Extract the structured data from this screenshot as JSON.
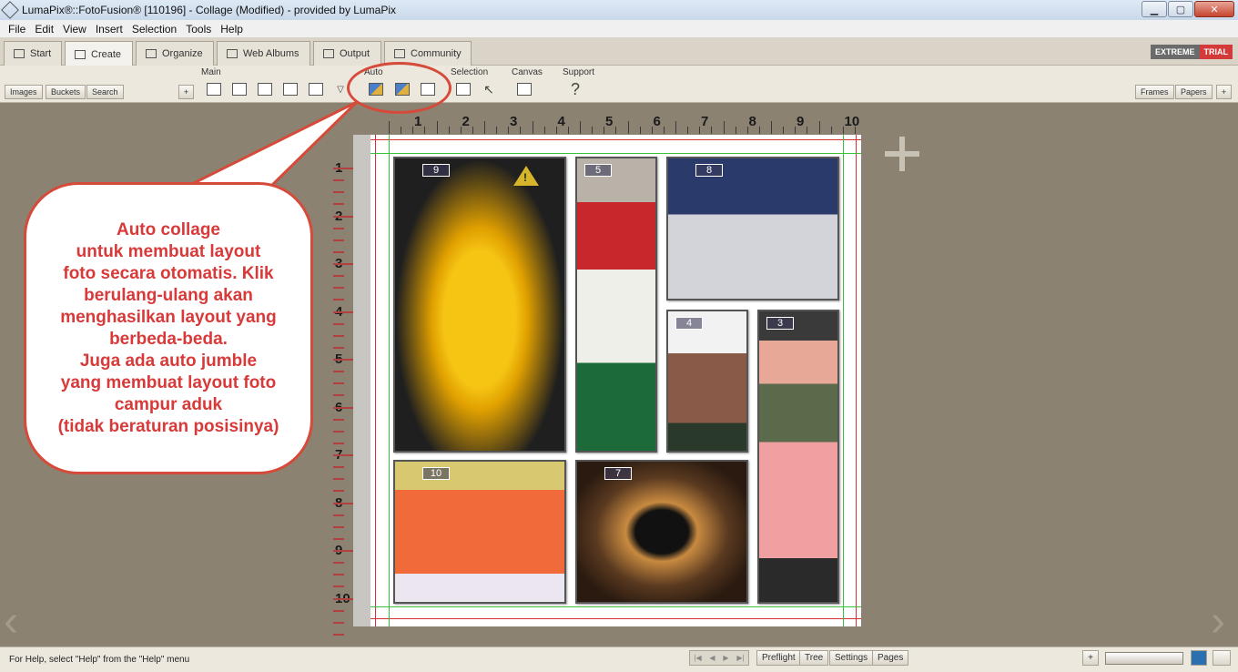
{
  "window": {
    "title": "LumaPix®::FotoFusion® [110196] - Collage (Modified) - provided by LumaPix",
    "minimize": "▁",
    "maximize": "▢",
    "close": "✕"
  },
  "menu": [
    "File",
    "Edit",
    "View",
    "Insert",
    "Selection",
    "Tools",
    "Help"
  ],
  "tabs": [
    {
      "label": "Start",
      "icon": "grid-icon"
    },
    {
      "label": "Create",
      "icon": "create-icon",
      "active": true
    },
    {
      "label": "Organize",
      "icon": "list-icon"
    },
    {
      "label": "Web Albums",
      "icon": "album-icon"
    },
    {
      "label": "Output",
      "icon": "arrow-icon"
    },
    {
      "label": "Community",
      "icon": "people-icon"
    }
  ],
  "edition": {
    "left": "EXTREME",
    "right": "TRIAL"
  },
  "toolbar": {
    "groups": [
      "Main",
      "Auto",
      "Selection",
      "Canvas",
      "Support"
    ],
    "left_buttons": [
      "Images",
      "Buckets",
      "Search"
    ],
    "right_buttons": [
      "Frames",
      "Papers"
    ],
    "plus": "+",
    "help_glyph": "?"
  },
  "ruler": {
    "h": [
      "1",
      "2",
      "3",
      "4",
      "5",
      "6",
      "7",
      "8",
      "9",
      "10"
    ],
    "v": [
      "1",
      "2",
      "3",
      "4",
      "5",
      "6",
      "7",
      "8",
      "9",
      "10"
    ]
  },
  "photos": [
    {
      "id": "9",
      "name": "juice-photo"
    },
    {
      "id": "5",
      "name": "snowman-photo"
    },
    {
      "id": "8",
      "name": "motorbike-photo"
    },
    {
      "id": "4",
      "name": "castle-photo"
    },
    {
      "id": "3",
      "name": "carnation-photo"
    },
    {
      "id": "10",
      "name": "papaya-photo"
    },
    {
      "id": "7",
      "name": "fountain-photo"
    }
  ],
  "callout": {
    "text": "Auto collage\nuntuk membuat layout\nfoto secara otomatis. Klik\nberulang-ulang akan\nmenghasilkan layout yang\nberbeda-beda.\nJuga ada auto jumble\nyang membuat layout foto\ncampur aduk\n(tidak beraturan posisinya)"
  },
  "status": {
    "help": "For Help, select \"Help\" from the \"Help\" menu",
    "buttons": [
      "Preflight",
      "Tree",
      "Settings",
      "Pages"
    ],
    "plus": "+"
  },
  "colors": {
    "accent": "#d64a3a",
    "callout_text": "#d83a3a",
    "trial": "#d43a3a"
  }
}
